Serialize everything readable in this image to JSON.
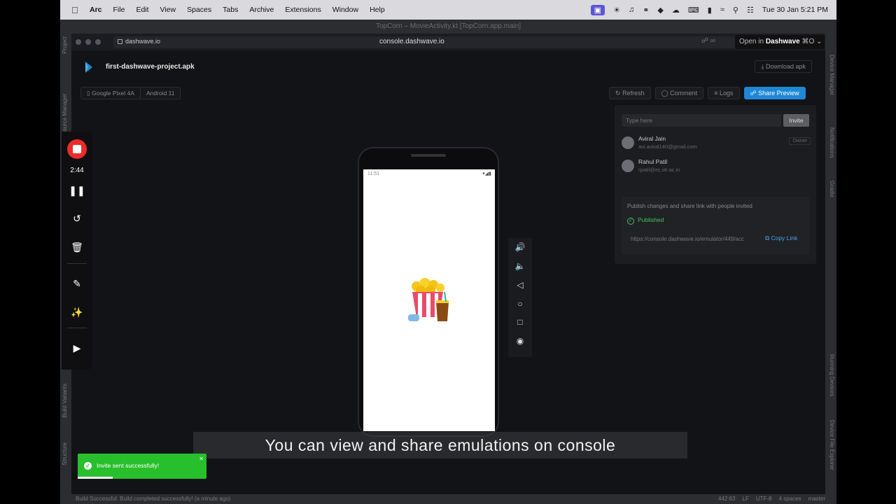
{
  "menubar": {
    "app": "Arc",
    "items": [
      "File",
      "Edit",
      "View",
      "Spaces",
      "Tabs",
      "Archive",
      "Extensions",
      "Window",
      "Help"
    ],
    "clock": "Tue 30 Jan  5:21 PM"
  },
  "ide": {
    "title": "TopCorn – MovieActivity.kt [TopCorn.app.main]",
    "left_tools": [
      "Project",
      "Resource Manager",
      "Build Variants",
      "Structure"
    ],
    "right_tools": [
      "Device Manager",
      "Notifications",
      "Gradle",
      "Running Devices",
      "Device File Explorer"
    ],
    "status_message": "Build Successful: Build completed successfully! (a minute ago)",
    "status_position": "442:63",
    "status_line_sep": "LF",
    "status_encoding": "UTF-8",
    "status_indent": "4 spaces",
    "status_branch": "master"
  },
  "browser": {
    "tab_site": "dashwave.io",
    "url": "console.dashwave.io",
    "open_in_prefix": "Open in",
    "open_in_app": "Dashwave",
    "open_in_shortcut": "⌘O"
  },
  "app": {
    "project_name": "first-dashwave-project.apk",
    "download_label": "Download apk",
    "device_model": "Google Pixel 4A",
    "android_version": "Android 11",
    "toolbar": {
      "refresh": "Refresh",
      "comment": "Comment",
      "logs": "Logs",
      "share": "Share Preview"
    }
  },
  "share": {
    "invite_placeholder": "Type here",
    "invite_button": "Invite",
    "members": [
      {
        "name": "Aviral Jain",
        "email": "avi.aviral140@gmail.com",
        "role": "Owner"
      },
      {
        "name": "Rahul Patil",
        "email": "rpatil@ec.iitr.ac.in",
        "role": ""
      }
    ],
    "publish_text": "Publish changes and share link with people invited",
    "status": "Published",
    "link": "https://console.dashwave.io/emulator/449/acc",
    "copy_label": "Copy Link"
  },
  "phone": {
    "time": "11:51",
    "status_icons": "▾◢▮"
  },
  "recorder": {
    "time": "2:44"
  },
  "caption": "You can view and share emulations on console",
  "toast": {
    "message": "Invite sent successfully!",
    "progress": 0.27
  },
  "colors": {
    "accent": "#1e88d6",
    "record": "#ee2b2b",
    "success": "#27c02c",
    "published": "#3fc45c"
  }
}
